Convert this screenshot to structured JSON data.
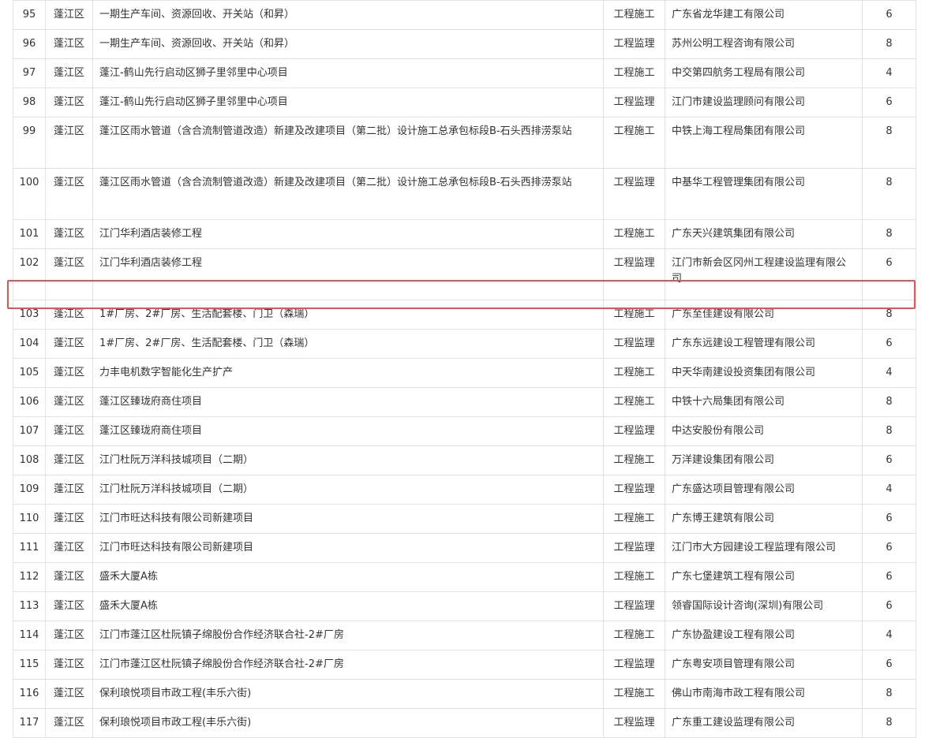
{
  "highlight": {
    "row_no": "103",
    "color": "#e05555"
  },
  "rows": [
    {
      "no": "95",
      "district": "蓬江区",
      "project": "一期生产车间、资源回收、开关站（和昇）",
      "type": "工程施工",
      "company": "广东省龙华建工有限公司",
      "score": "6"
    },
    {
      "no": "96",
      "district": "蓬江区",
      "project": "一期生产车间、资源回收、开关站（和昇）",
      "type": "工程监理",
      "company": "苏州公明工程咨询有限公司",
      "score": "8"
    },
    {
      "no": "97",
      "district": "蓬江区",
      "project": "蓬江-鹤山先行启动区狮子里邻里中心项目",
      "type": "工程施工",
      "company": "中交第四航务工程局有限公司",
      "score": "4"
    },
    {
      "no": "98",
      "district": "蓬江区",
      "project": "蓬江-鹤山先行启动区狮子里邻里中心项目",
      "type": "工程监理",
      "company": "江门市建设监理顾问有限公司",
      "score": "6"
    },
    {
      "no": "99",
      "district": "蓬江区",
      "project": "蓬江区雨水管道（含合流制管道改造）新建及改建项目（第二批）设计施工总承包标段B-石头西排涝泵站",
      "type": "工程施工",
      "company": "中铁上海工程局集团有限公司",
      "score": "8"
    },
    {
      "no": "100",
      "district": "蓬江区",
      "project": "蓬江区雨水管道（含合流制管道改造）新建及改建项目（第二批）设计施工总承包标段B-石头西排涝泵站",
      "type": "工程监理",
      "company": "中基华工程管理集团有限公司",
      "score": "8"
    },
    {
      "no": "101",
      "district": "蓬江区",
      "project": "江门华利酒店装修工程",
      "type": "工程施工",
      "company": "广东天兴建筑集团有限公司",
      "score": "8"
    },
    {
      "no": "102",
      "district": "蓬江区",
      "project": "江门华利酒店装修工程",
      "type": "工程监理",
      "company": "江门市新会区冈州工程建设监理有限公司",
      "score": "6"
    },
    {
      "no": "103",
      "district": "蓬江区",
      "project": "1#厂房、2#厂房、生活配套楼、门卫（森瑞）",
      "type": "工程施工",
      "company": "广东至佳建设有限公司",
      "score": "8"
    },
    {
      "no": "104",
      "district": "蓬江区",
      "project": "1#厂房、2#厂房、生活配套楼、门卫（森瑞）",
      "type": "工程监理",
      "company": "广东东远建设工程管理有限公司",
      "score": "6"
    },
    {
      "no": "105",
      "district": "蓬江区",
      "project": "力丰电机数字智能化生产扩产",
      "type": "工程施工",
      "company": "中天华南建设投资集团有限公司",
      "score": "4"
    },
    {
      "no": "106",
      "district": "蓬江区",
      "project": "蓬江区臻珑府商住项目",
      "type": "工程施工",
      "company": "中铁十六局集团有限公司",
      "score": "8"
    },
    {
      "no": "107",
      "district": "蓬江区",
      "project": "蓬江区臻珑府商住项目",
      "type": "工程监理",
      "company": "中达安股份有限公司",
      "score": "8"
    },
    {
      "no": "108",
      "district": "蓬江区",
      "project": "江门杜阮万洋科技城项目（二期）",
      "type": "工程施工",
      "company": "万洋建设集团有限公司",
      "score": "6"
    },
    {
      "no": "109",
      "district": "蓬江区",
      "project": "江门杜阮万洋科技城项目（二期）",
      "type": "工程监理",
      "company": "广东盛达项目管理有限公司",
      "score": "4"
    },
    {
      "no": "110",
      "district": "蓬江区",
      "project": "江门市旺达科技有限公司新建项目",
      "type": "工程施工",
      "company": "广东博王建筑有限公司",
      "score": "6"
    },
    {
      "no": "111",
      "district": "蓬江区",
      "project": "江门市旺达科技有限公司新建项目",
      "type": "工程监理",
      "company": "江门市大方园建设工程监理有限公司",
      "score": "6"
    },
    {
      "no": "112",
      "district": "蓬江区",
      "project": "盛禾大厦A栋",
      "type": "工程施工",
      "company": "广东七堡建筑工程有限公司",
      "score": "6"
    },
    {
      "no": "113",
      "district": "蓬江区",
      "project": "盛禾大厦A栋",
      "type": "工程监理",
      "company": "领睿国际设计咨询(深圳)有限公司",
      "score": "6"
    },
    {
      "no": "114",
      "district": "蓬江区",
      "project": "江门市蓬江区杜阮镇子绵股份合作经济联合社-2#厂房",
      "type": "工程施工",
      "company": "广东协盈建设工程有限公司",
      "score": "4"
    },
    {
      "no": "115",
      "district": "蓬江区",
      "project": "江门市蓬江区杜阮镇子绵股份合作经济联合社-2#厂房",
      "type": "工程监理",
      "company": "广东粤安项目管理有限公司",
      "score": "6"
    },
    {
      "no": "116",
      "district": "蓬江区",
      "project": "保利琅悦项目市政工程(丰乐六街)",
      "type": "工程施工",
      "company": "佛山市南海市政工程有限公司",
      "score": "8"
    },
    {
      "no": "117",
      "district": "蓬江区",
      "project": "保利琅悦项目市政工程(丰乐六街)",
      "type": "工程监理",
      "company": "广东重工建设监理有限公司",
      "score": "8"
    }
  ]
}
